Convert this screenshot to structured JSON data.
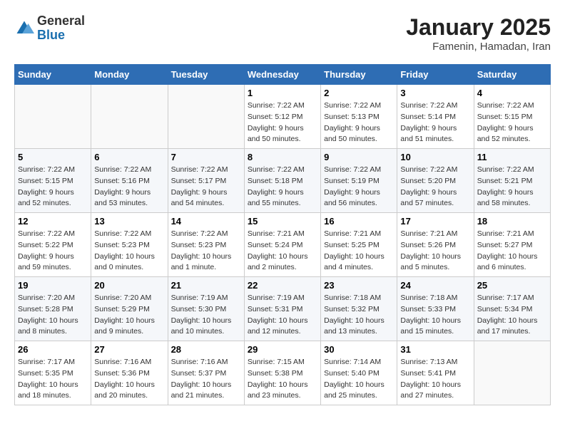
{
  "header": {
    "logo_general": "General",
    "logo_blue": "Blue",
    "title": "January 2025",
    "subtitle": "Famenin, Hamadan, Iran"
  },
  "columns": [
    "Sunday",
    "Monday",
    "Tuesday",
    "Wednesday",
    "Thursday",
    "Friday",
    "Saturday"
  ],
  "weeks": [
    [
      {
        "num": "",
        "detail": ""
      },
      {
        "num": "",
        "detail": ""
      },
      {
        "num": "",
        "detail": ""
      },
      {
        "num": "1",
        "detail": "Sunrise: 7:22 AM\nSunset: 5:12 PM\nDaylight: 9 hours\nand 50 minutes."
      },
      {
        "num": "2",
        "detail": "Sunrise: 7:22 AM\nSunset: 5:13 PM\nDaylight: 9 hours\nand 50 minutes."
      },
      {
        "num": "3",
        "detail": "Sunrise: 7:22 AM\nSunset: 5:14 PM\nDaylight: 9 hours\nand 51 minutes."
      },
      {
        "num": "4",
        "detail": "Sunrise: 7:22 AM\nSunset: 5:15 PM\nDaylight: 9 hours\nand 52 minutes."
      }
    ],
    [
      {
        "num": "5",
        "detail": "Sunrise: 7:22 AM\nSunset: 5:15 PM\nDaylight: 9 hours\nand 52 minutes."
      },
      {
        "num": "6",
        "detail": "Sunrise: 7:22 AM\nSunset: 5:16 PM\nDaylight: 9 hours\nand 53 minutes."
      },
      {
        "num": "7",
        "detail": "Sunrise: 7:22 AM\nSunset: 5:17 PM\nDaylight: 9 hours\nand 54 minutes."
      },
      {
        "num": "8",
        "detail": "Sunrise: 7:22 AM\nSunset: 5:18 PM\nDaylight: 9 hours\nand 55 minutes."
      },
      {
        "num": "9",
        "detail": "Sunrise: 7:22 AM\nSunset: 5:19 PM\nDaylight: 9 hours\nand 56 minutes."
      },
      {
        "num": "10",
        "detail": "Sunrise: 7:22 AM\nSunset: 5:20 PM\nDaylight: 9 hours\nand 57 minutes."
      },
      {
        "num": "11",
        "detail": "Sunrise: 7:22 AM\nSunset: 5:21 PM\nDaylight: 9 hours\nand 58 minutes."
      }
    ],
    [
      {
        "num": "12",
        "detail": "Sunrise: 7:22 AM\nSunset: 5:22 PM\nDaylight: 9 hours\nand 59 minutes."
      },
      {
        "num": "13",
        "detail": "Sunrise: 7:22 AM\nSunset: 5:23 PM\nDaylight: 10 hours\nand 0 minutes."
      },
      {
        "num": "14",
        "detail": "Sunrise: 7:22 AM\nSunset: 5:23 PM\nDaylight: 10 hours\nand 1 minute."
      },
      {
        "num": "15",
        "detail": "Sunrise: 7:21 AM\nSunset: 5:24 PM\nDaylight: 10 hours\nand 2 minutes."
      },
      {
        "num": "16",
        "detail": "Sunrise: 7:21 AM\nSunset: 5:25 PM\nDaylight: 10 hours\nand 4 minutes."
      },
      {
        "num": "17",
        "detail": "Sunrise: 7:21 AM\nSunset: 5:26 PM\nDaylight: 10 hours\nand 5 minutes."
      },
      {
        "num": "18",
        "detail": "Sunrise: 7:21 AM\nSunset: 5:27 PM\nDaylight: 10 hours\nand 6 minutes."
      }
    ],
    [
      {
        "num": "19",
        "detail": "Sunrise: 7:20 AM\nSunset: 5:28 PM\nDaylight: 10 hours\nand 8 minutes."
      },
      {
        "num": "20",
        "detail": "Sunrise: 7:20 AM\nSunset: 5:29 PM\nDaylight: 10 hours\nand 9 minutes."
      },
      {
        "num": "21",
        "detail": "Sunrise: 7:19 AM\nSunset: 5:30 PM\nDaylight: 10 hours\nand 10 minutes."
      },
      {
        "num": "22",
        "detail": "Sunrise: 7:19 AM\nSunset: 5:31 PM\nDaylight: 10 hours\nand 12 minutes."
      },
      {
        "num": "23",
        "detail": "Sunrise: 7:18 AM\nSunset: 5:32 PM\nDaylight: 10 hours\nand 13 minutes."
      },
      {
        "num": "24",
        "detail": "Sunrise: 7:18 AM\nSunset: 5:33 PM\nDaylight: 10 hours\nand 15 minutes."
      },
      {
        "num": "25",
        "detail": "Sunrise: 7:17 AM\nSunset: 5:34 PM\nDaylight: 10 hours\nand 17 minutes."
      }
    ],
    [
      {
        "num": "26",
        "detail": "Sunrise: 7:17 AM\nSunset: 5:35 PM\nDaylight: 10 hours\nand 18 minutes."
      },
      {
        "num": "27",
        "detail": "Sunrise: 7:16 AM\nSunset: 5:36 PM\nDaylight: 10 hours\nand 20 minutes."
      },
      {
        "num": "28",
        "detail": "Sunrise: 7:16 AM\nSunset: 5:37 PM\nDaylight: 10 hours\nand 21 minutes."
      },
      {
        "num": "29",
        "detail": "Sunrise: 7:15 AM\nSunset: 5:38 PM\nDaylight: 10 hours\nand 23 minutes."
      },
      {
        "num": "30",
        "detail": "Sunrise: 7:14 AM\nSunset: 5:40 PM\nDaylight: 10 hours\nand 25 minutes."
      },
      {
        "num": "31",
        "detail": "Sunrise: 7:13 AM\nSunset: 5:41 PM\nDaylight: 10 hours\nand 27 minutes."
      },
      {
        "num": "",
        "detail": ""
      }
    ]
  ]
}
